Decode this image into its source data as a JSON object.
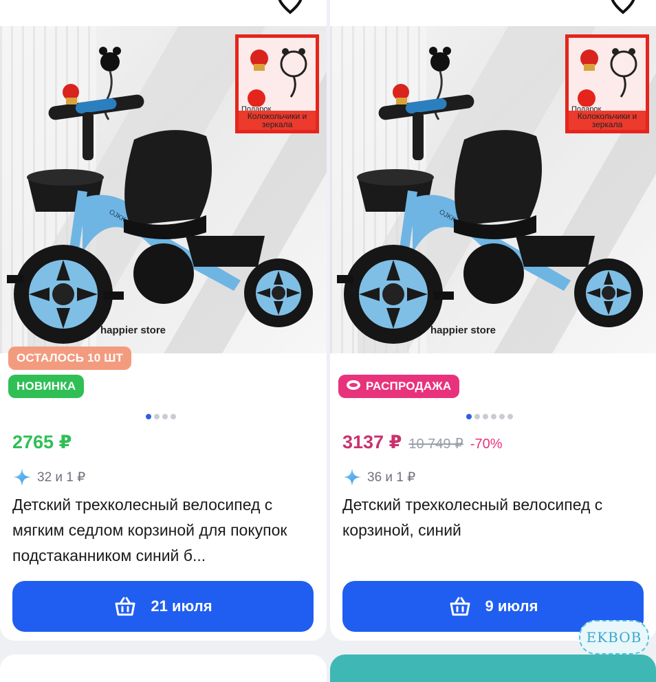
{
  "colors": {
    "price_regular": "#2fbf55",
    "price_sale": "#e8337c",
    "cta": "#1f5ef0",
    "badge_stock": "#f39b7e",
    "badge_new": "#2fbf55",
    "badge_sale": "#e8337c"
  },
  "products": [
    {
      "photo": {
        "gift_label": "Подарок",
        "gift_caption": "Колокольчики и зеркала",
        "store_label": "happier store",
        "frame_label": "OJKK-X"
      },
      "badges": [
        "ОСТАЛОСЬ 10 ШТ",
        "НОВИНКА"
      ],
      "carousel": {
        "count": 4,
        "active": 1
      },
      "price": "2765 ₽",
      "old_price": "",
      "discount": "",
      "reviews": "32 и 1 ₽",
      "title": "Детский трехколесный велосипед с мягким седлом корзиной для покупок подстаканником синий б...",
      "delivery_button": "21 июля",
      "icons": {
        "favorite": "heart-icon",
        "cart": "basket-icon",
        "reviews": "sparkle-icon"
      }
    },
    {
      "photo": {
        "gift_label": "Подарок",
        "gift_caption": "Колокольчики и зеркала",
        "store_label": "happier store",
        "frame_label": "OJKK-X"
      },
      "badges": [
        "РАСПРОДАЖА"
      ],
      "carousel": {
        "count": 6,
        "active": 1
      },
      "price": "3137 ₽",
      "old_price": "10 749 ₽",
      "discount": "-70%",
      "reviews": "36 и 1 ₽",
      "title": "Детский трехколесный велосипед с корзиной, синий",
      "delivery_button": "9 июля",
      "icons": {
        "favorite": "heart-icon",
        "cart": "basket-icon",
        "reviews": "sparkle-icon"
      }
    }
  ],
  "watermark": "EKBOB"
}
